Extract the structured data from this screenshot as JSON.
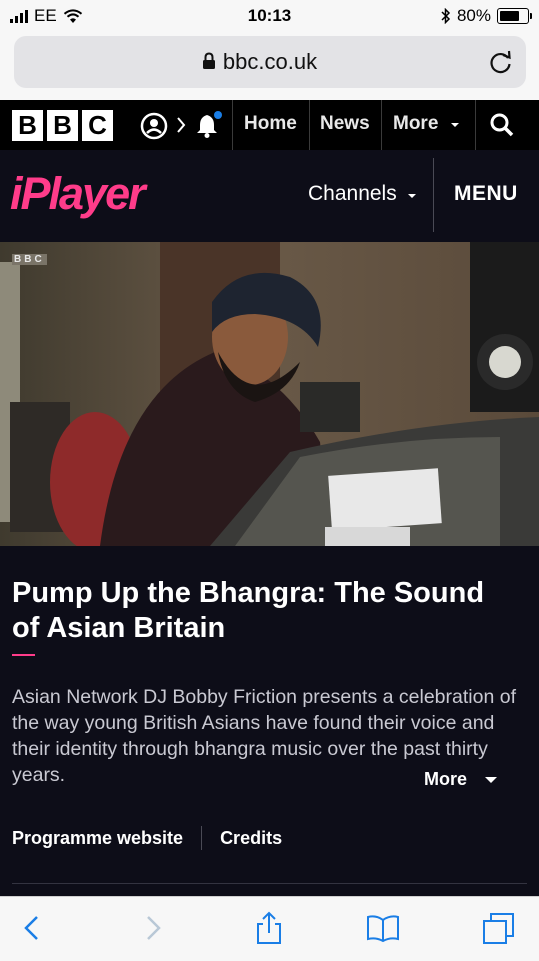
{
  "status_bar": {
    "carrier": "EE",
    "time": "10:13",
    "battery": "80%",
    "battery_level": 0.8
  },
  "browser": {
    "url": "bbc.co.uk"
  },
  "bbc_nav": {
    "logo_letters": [
      "B",
      "B",
      "C"
    ],
    "items": [
      {
        "label": "Home"
      },
      {
        "label": "News"
      },
      {
        "label": "More"
      }
    ]
  },
  "iplayer": {
    "logo": "iPlayer",
    "channels_label": "Channels",
    "menu_label": "MENU"
  },
  "hero": {
    "watermark": "BBC"
  },
  "programme": {
    "title": "Pump Up the Bhangra: The Sound of Asian Britain",
    "description": "Asian Network DJ Bobby Friction presents a celebration of the way young British Asians have found their voice and their identity through bhangra music over the past thirty years.",
    "more_label": "More",
    "links": [
      {
        "label": "Programme website"
      },
      {
        "label": "Credits"
      }
    ]
  },
  "colors": {
    "accent": "#ff3c8a",
    "page_bg": "#0d0d18",
    "nav_bg": "#000000",
    "notification_dot": "#1a7ee6"
  }
}
